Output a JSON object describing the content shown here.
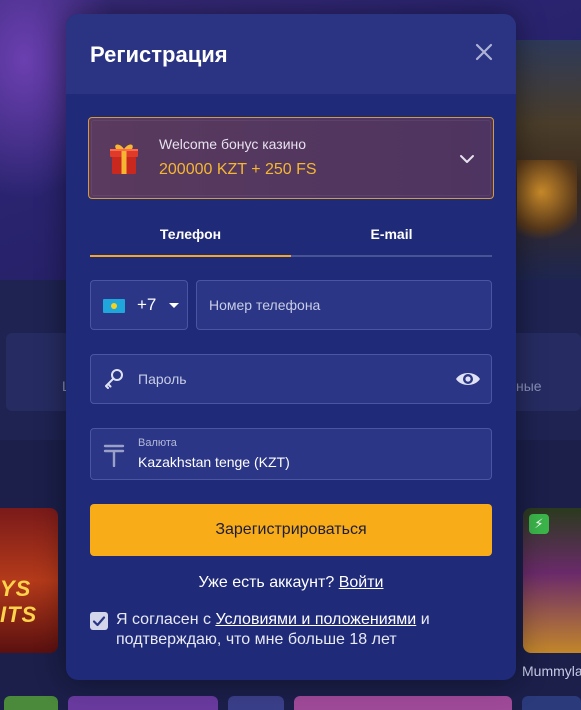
{
  "background": {
    "side_labels": {
      "left": "L",
      "right": "ные"
    },
    "left_tile_text": "YS ITS",
    "right_tile_label": "Mummyla"
  },
  "modal": {
    "title": "Регистрация",
    "close_icon": "close-icon",
    "bonus": {
      "icon": "gift-icon",
      "label": "Welcome бонус казино",
      "value": "200000 KZT + 250 FS"
    },
    "tabs": [
      {
        "label": "Телефон",
        "active": true
      },
      {
        "label": "E-mail",
        "active": false
      }
    ],
    "phone": {
      "country_code": "+7",
      "flag": "kazakhstan-flag",
      "placeholder": "Номер телефона"
    },
    "password": {
      "placeholder": "Пароль"
    },
    "currency": {
      "label": "Валюта",
      "value": "Kazakhstan tenge (KZT)"
    },
    "register_label": "Зарегистрироваться",
    "have_account": {
      "text": "Уже есть аккаунт?",
      "link": "Войти"
    },
    "consent": {
      "checked": true,
      "prefix": "Я согласен с",
      "link": "Условиями и положениями",
      "suffix": "и подтверждаю, что мне больше 18 лет"
    }
  },
  "colors": {
    "accent": "#f7ac18",
    "bonus_value": "#f5b731",
    "modal_bg": "#1f2a78",
    "field_bg": "#2b3686"
  }
}
